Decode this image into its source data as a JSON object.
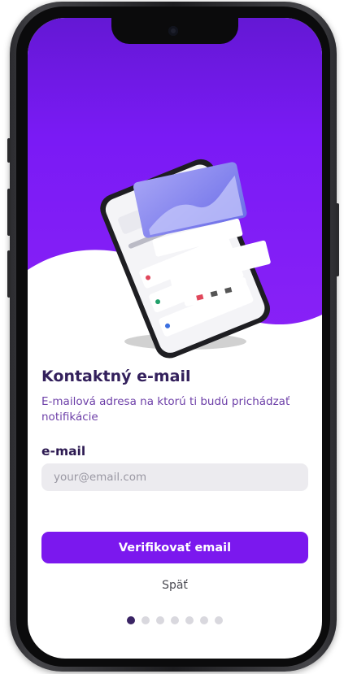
{
  "onboarding": {
    "title": "Kontaktný e-mail",
    "subtitle": "E-mailová adresa na ktorú ti budú prichádzať notifikácie",
    "email_label": "e-mail",
    "email_placeholder": "your@email.com",
    "email_value": "",
    "verify_button": "Verifikovať email",
    "back_link": "Späť"
  },
  "pagination": {
    "total": 7,
    "active_index": 0
  },
  "colors": {
    "brand_purple": "#7b18ee",
    "title_text": "#33205c",
    "subtitle_text": "#6d3fa8",
    "input_bg": "#ecebef",
    "dot_active": "#3a2464",
    "dot_inactive": "#d9d8de"
  },
  "icons": [
    "phone-illustration"
  ]
}
